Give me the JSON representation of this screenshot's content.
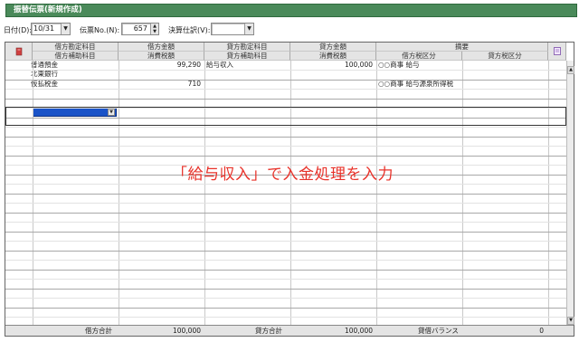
{
  "window": {
    "title": "振替伝票(新規作成)"
  },
  "toolbar": {
    "date_label": "日付(D):",
    "date_value": "10/31",
    "slip_label": "伝票No.(N):",
    "slip_value": "657",
    "closing_label": "決算仕訳(V):",
    "closing_value": ""
  },
  "header": {
    "row1": [
      "借方勘定科目",
      "借方金額",
      "貸方勘定科目",
      "貸方金額",
      "摘要"
    ],
    "row2": [
      "借方補助科目",
      "消費税額",
      "貸方補助科目",
      "消費税額",
      "借方税区分",
      "貸方税区分"
    ]
  },
  "rows": [
    {
      "debit_account": "普通預金",
      "debit_amount": "99,290",
      "credit_account": "給与収入",
      "credit_amount": "100,000",
      "summary": "○○商事 給与"
    },
    {
      "debit_account": "北東銀行",
      "debit_amount": "",
      "credit_account": "",
      "credit_amount": "",
      "summary": ""
    },
    {
      "debit_account": "仮払税金",
      "debit_amount": "710",
      "credit_account": "",
      "credit_amount": "",
      "summary": "○○商事 給与源泉所得税"
    }
  ],
  "footer": {
    "debit_total_label": "借方合計",
    "debit_total": "100,000",
    "credit_total_label": "貸方合計",
    "credit_total": "100,000",
    "balance_label": "貸借バランス",
    "balance": "0"
  },
  "annotation": "「給与収入」で入金処理を入力",
  "colors": {
    "title_bar": "#4a8a5a",
    "annotation": "#e8322a"
  }
}
